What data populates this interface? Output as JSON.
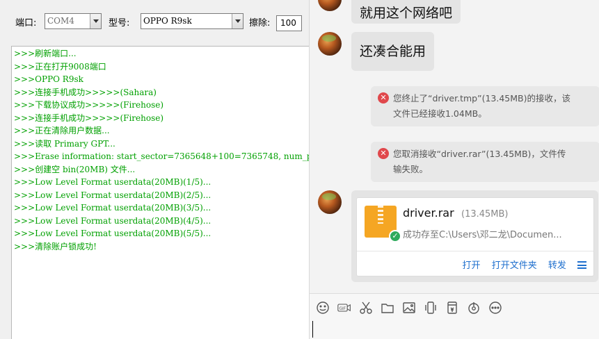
{
  "tool": {
    "port_label": "端口:",
    "port_value": "COM4",
    "model_label": "型号:",
    "model_value": "OPPO R9sk",
    "erase_label": "擦除:",
    "erase_value": "100",
    "log": [
      ">>>刷新端口...",
      ">>>正在打开9008端口",
      ">>>OPPO R9sk",
      ">>>连接手机成功>>>>>(Sahara)",
      ">>>下载协议成功>>>>>(Firehose)",
      ">>>连接手机成功>>>>>(Firehose)",
      ">>>正在清除用户数据...",
      ">>>读取 Primary GPT...",
      ">>>Erase information: start_sector=7365648+100=7365748, num_p",
      ">>>创建空 bin(20MB) 文件...",
      ">>>Low Level Format userdata(20MB)(1/5)...",
      ">>>Low Level Format userdata(20MB)(2/5)...",
      ">>>Low Level Format userdata(20MB)(3/5)...",
      ">>>Low Level Format userdata(20MB)(4/5)...",
      ">>>Low Level Format userdata(20MB)(5/5)...",
      ">>>清除账户锁成功!"
    ],
    "log_color": "#00a000"
  },
  "chat": {
    "messages": [
      {
        "text": "就用这个网络吧"
      },
      {
        "text": "还凑合能用"
      }
    ],
    "system": [
      {
        "line1": "您终止了“driver.tmp”(13.45MB)的接收，该",
        "line2": "文件已经接收1.04MB。"
      },
      {
        "line1": "您取消接收“driver.rar”(13.45MB)，文件传",
        "line2": "输失败。"
      }
    ],
    "file": {
      "name": "driver.rar",
      "size": "(13.45MB)",
      "status": "成功存至C:\\Users\\邓二龙\\Documen...",
      "actions": [
        "打开",
        "打开文件夹",
        "转发"
      ],
      "icon": "zip-file-icon"
    },
    "toolbar_icons": [
      "emoji-icon",
      "gif-icon",
      "scissors-icon",
      "folder-icon",
      "image-icon",
      "vibrate-icon",
      "red-packet-icon",
      "voice-icon",
      "more-icon"
    ],
    "accent_color": "#1e6fce",
    "error_color": "#e0484c"
  }
}
